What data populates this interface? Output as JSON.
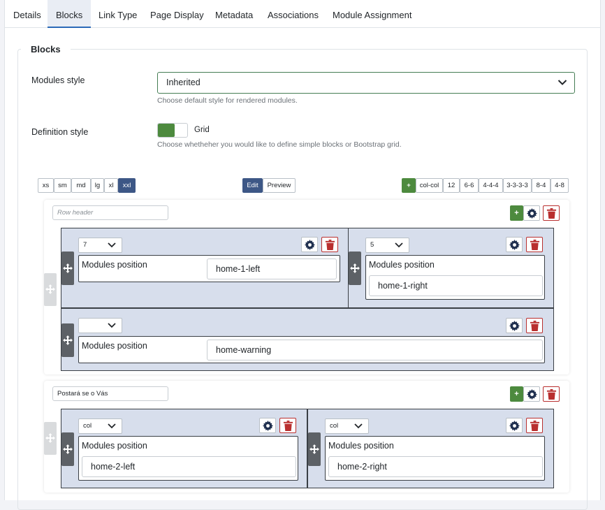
{
  "tabs": [
    "Details",
    "Blocks",
    "Link Type",
    "Page Display",
    "Metadata",
    "Associations",
    "Module Assignment"
  ],
  "active_tab": "Blocks",
  "fieldset_legend": "Blocks",
  "modules_style": {
    "label": "Modules style",
    "value": "Inherited",
    "description": "Choose default style for rendered modules."
  },
  "definition_style": {
    "label": "Definition style",
    "toggle_label": "Grid",
    "toggle_on": true,
    "description": "Choose whetheher you would like to define simple blocks or Bootstrap grid."
  },
  "breakpoints": [
    "xs",
    "sm",
    "md",
    "lg",
    "xl",
    "xxl"
  ],
  "active_breakpoint": "xxl",
  "modes": [
    "Edit",
    "Preview"
  ],
  "active_mode": "Edit",
  "layout_presets": [
    "+",
    "col-col",
    "12",
    "6-6",
    "4-4-4",
    "3-3-3-3",
    "8-4",
    "4-8"
  ],
  "rows": [
    {
      "header_value": "",
      "header_placeholder": "Row header",
      "columns": [
        {
          "size": "7",
          "label": "Modules position",
          "position": "home-1-left"
        },
        {
          "size": "5",
          "label": "Modules position",
          "position": "home-1-right"
        },
        {
          "size": "",
          "label": "Modules position",
          "position": "home-warning"
        }
      ]
    },
    {
      "header_value": "Postará se o Vás",
      "header_placeholder": "Row header",
      "columns": [
        {
          "size": "col",
          "label": "Modules position",
          "position": "home-2-left"
        },
        {
          "size": "col",
          "label": "Modules position",
          "position": "home-2-right"
        }
      ]
    }
  ],
  "icons": {
    "move": "arrows-move-icon",
    "settings": "gear-icon",
    "delete": "trash-icon",
    "dropdown": "chevron-down-icon"
  },
  "colors": {
    "accent_dark": "#3d5786",
    "success": "#4d8a3e",
    "danger": "#b92f2f",
    "column_bg": "#d7deec"
  }
}
